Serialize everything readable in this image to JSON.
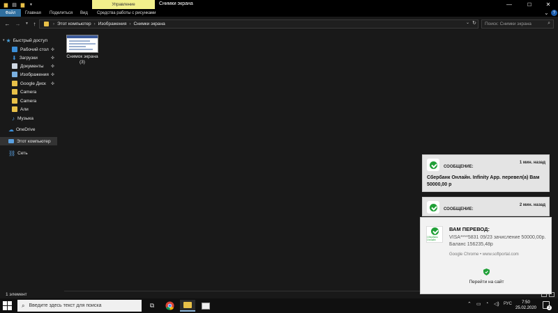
{
  "window": {
    "manage_tab": "Управление",
    "title": "Снимки экрана",
    "min": "—",
    "max": "☐",
    "close": "✕"
  },
  "ribbon": {
    "tabs": [
      "Файл",
      "Главная",
      "Поделиться",
      "Вид",
      "Средства работы с рисунками"
    ],
    "expand": "⌄",
    "help": "?"
  },
  "address": {
    "crumbs": [
      "Этот компьютер",
      "Изображения",
      "Снимки экрана"
    ],
    "search_placeholder": "Поиск: Снимки экрана"
  },
  "sidebar": {
    "items": [
      {
        "label": "Быстрый доступ",
        "icon": "star-icon",
        "color": "#4aa3df"
      },
      {
        "label": "Рабочий стол",
        "icon": "desktop-icon",
        "color": "#3c8fd8",
        "pinned": true
      },
      {
        "label": "Загрузки",
        "icon": "download-icon",
        "color": "#3c8fd8",
        "pinned": true
      },
      {
        "label": "Документы",
        "icon": "document-icon",
        "color": "#cfd8e3",
        "pinned": true
      },
      {
        "label": "Изображения",
        "icon": "picture-icon",
        "color": "#7ab0e0",
        "pinned": true
      },
      {
        "label": "Google Диск",
        "icon": "folder-icon",
        "color": "#e8c048",
        "pinned": true
      },
      {
        "label": "Camera",
        "icon": "folder-icon",
        "color": "#e8c048"
      },
      {
        "label": "Camera",
        "icon": "folder-icon",
        "color": "#e8c048"
      },
      {
        "label": "Али",
        "icon": "folder-icon",
        "color": "#e8c048"
      },
      {
        "label": "Музыка",
        "icon": "music-icon",
        "color": "#5aa0e0"
      },
      {
        "label": "OneDrive",
        "icon": "cloud-icon",
        "color": "#3c8fd8"
      },
      {
        "label": "Этот компьютер",
        "icon": "computer-icon",
        "color": "#5aa0e0"
      },
      {
        "label": "Сеть",
        "icon": "network-icon",
        "color": "#5aa0e0"
      }
    ]
  },
  "content": {
    "folder_name": "Снимок экрана",
    "folder_count": "(3)"
  },
  "status": {
    "text": "1 элемент"
  },
  "notifications": {
    "card1": {
      "label": "СООБЩЕНИЕ:",
      "time": "1 мин. назад",
      "body": "Сбербанк Онлайн. Infinity App. перевел(а) Вам 50000,00 р"
    },
    "card2": {
      "label": "СООБЩЕНИЕ:",
      "time": "2 мин. назад"
    },
    "main": {
      "logo_text": "Сбербанк Онлайн",
      "title": "ВАМ ПЕРЕВОД:",
      "text": "VISA****5831 09/23 зачисление 50000,00р. Баланс 156235,48р",
      "source": "Google Chrome • www.softportal.com",
      "action": "Перейти на сайт"
    }
  },
  "taskbar": {
    "search_placeholder": "Введите здесь текст для поиска",
    "lang": "РУС",
    "time": "7:50",
    "date": "25.02.2020",
    "notif_count": "2"
  }
}
